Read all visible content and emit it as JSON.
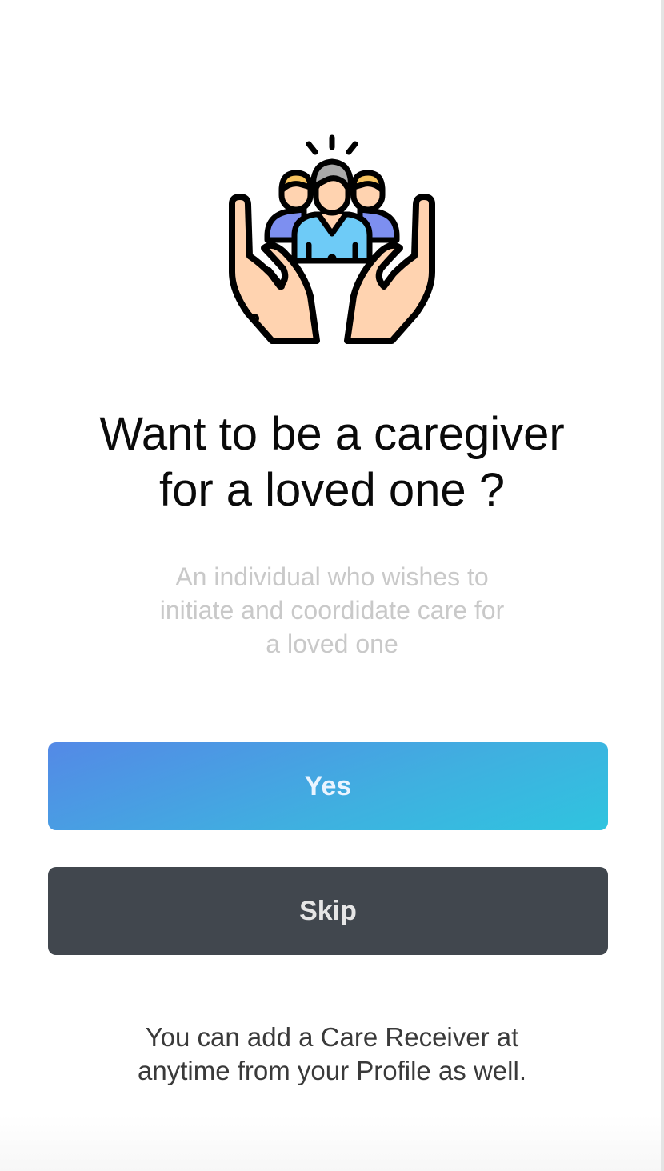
{
  "illustration": {
    "icon": "caregiver-hands-icon",
    "colors": {
      "skin": "#ffd3b0",
      "hair_gray": "#a9a9a9",
      "hair_blond": "#f7c35f",
      "shirt_center": "#6ecbf7",
      "shirt_side": "#7d8ff0",
      "outline": "#000000"
    }
  },
  "title": "Want to be a caregiver\nfor a loved one ?",
  "subtitle": "An individual who wishes to\ninitiate and coordidate care for\na loved one",
  "buttons": {
    "yes_label": "Yes",
    "skip_label": "Skip"
  },
  "footer_note": "You can add a Care Receiver at\nanytime from your Profile as well.",
  "colors": {
    "yes_gradient_start": "#5489e6",
    "yes_gradient_end": "#2fc4df",
    "skip_background": "#41474e",
    "subtitle_text": "#c9c9c9"
  }
}
